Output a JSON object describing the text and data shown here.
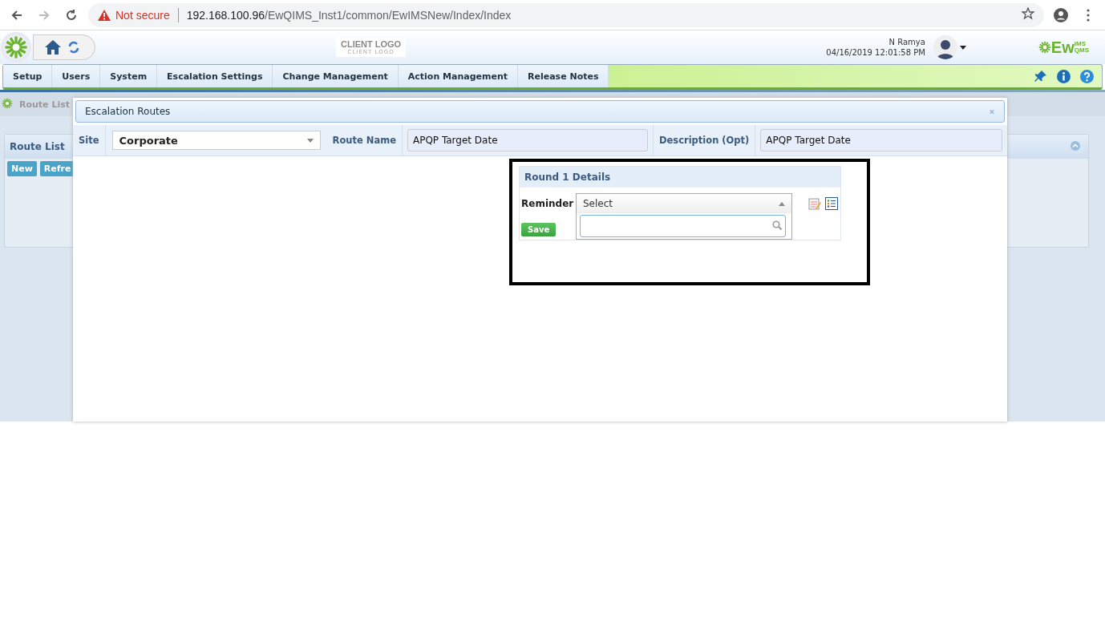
{
  "browser": {
    "security": "Not secure",
    "url_host": "192.168.100.96",
    "url_path": "/EwQIMS_Inst1/common/EwIMSNew/Index/Index"
  },
  "header": {
    "client_logo": "CLIENT LOGO",
    "client_logo_sub": "CLIENT LOGO",
    "user": "N Ramya",
    "datetime": "04/16/2019 12:01:58 PM",
    "brand": "Ew",
    "brand_top": "IMS",
    "brand_bottom": "QMS"
  },
  "nav": [
    {
      "label": "Setup",
      "selected": false
    },
    {
      "label": "Users",
      "selected": false
    },
    {
      "label": "System",
      "selected": false
    },
    {
      "label": "Escalation Settings",
      "selected": false
    },
    {
      "label": "Change Management",
      "selected": false
    },
    {
      "label": "Action Management",
      "selected": false
    },
    {
      "label": "Release Notes",
      "selected": false
    }
  ],
  "breadcrumb": "Route List",
  "route_list": {
    "title": "Route List",
    "buttons": [
      "New",
      "Refre"
    ]
  },
  "dialog": {
    "title": "Escalation Routes",
    "site_label": "Site",
    "site_value": "Corporate",
    "route_name_label": "Route Name",
    "route_name_value": "APQP Target Date",
    "description_label": "Description (Opt)",
    "description_value": "APQP Target Date",
    "round": {
      "title": "Round 1 Details",
      "reminder_label": "Reminder",
      "reminder_value": "Select",
      "expanded": true,
      "save": "Save"
    }
  }
}
